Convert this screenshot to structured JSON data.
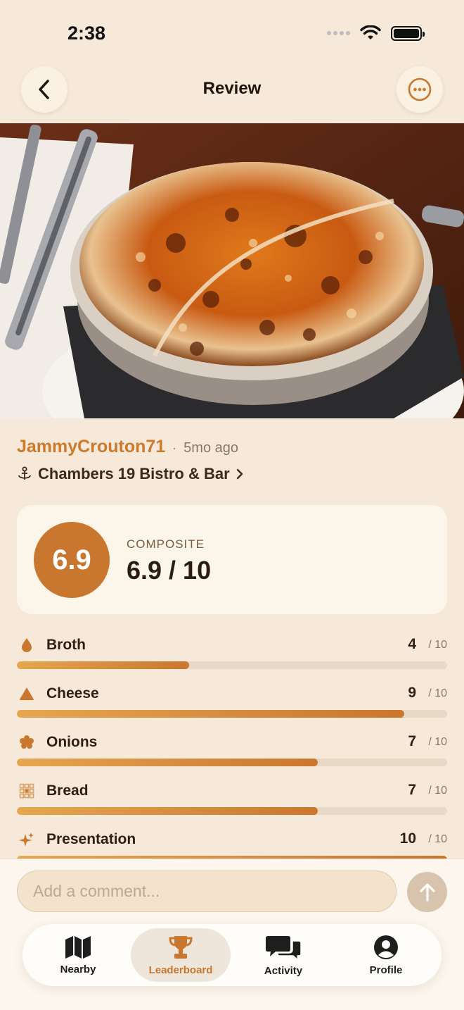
{
  "status_bar": {
    "time": "2:38"
  },
  "header": {
    "title": "Review",
    "back_icon": "chevron-left-icon",
    "more_icon": "ellipsis-circle-icon"
  },
  "review": {
    "username": "JammyCrouton71",
    "separator": "·",
    "time_ago": "5mo ago",
    "location": "Chambers 19 Bistro & Bar",
    "composite": {
      "badge": "6.9",
      "label": "COMPOSITE",
      "value": "6.9 / 10"
    },
    "ratings": [
      {
        "label": "Broth",
        "score": "4",
        "max": "/ 10",
        "fraction": 0.4,
        "icon": "drop-icon"
      },
      {
        "label": "Cheese",
        "score": "9",
        "max": "/ 10",
        "fraction": 0.9,
        "icon": "cheese-icon"
      },
      {
        "label": "Onions",
        "score": "7",
        "max": "/ 10",
        "fraction": 0.7,
        "icon": "onion-icon"
      },
      {
        "label": "Bread",
        "score": "7",
        "max": "/ 10",
        "fraction": 0.7,
        "icon": "bread-icon"
      },
      {
        "label": "Presentation",
        "score": "10",
        "max": "/ 10",
        "fraction": 1.0,
        "icon": "sparkle-icon"
      }
    ]
  },
  "comment": {
    "placeholder": "Add a comment..."
  },
  "tabs": [
    {
      "label": "Nearby",
      "icon": "map-icon",
      "active": false
    },
    {
      "label": "Leaderboard",
      "icon": "trophy-icon",
      "active": true
    },
    {
      "label": "Activity",
      "icon": "chat-bubbles-icon",
      "active": false
    },
    {
      "label": "Profile",
      "icon": "person-circle-icon",
      "active": false
    }
  ],
  "colors": {
    "accent": "#c9772e",
    "background": "#f6e9d9",
    "card": "#fcf5ea"
  }
}
